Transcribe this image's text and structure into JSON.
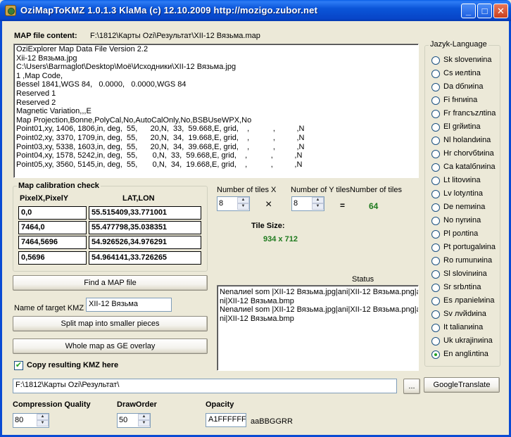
{
  "window": {
    "title": "OziMapToKMZ  1.0.1.3 KlaMa (c) 12.10.2009 http://mozigo.zubor.net",
    "minimize_label": "_",
    "maximize_label": "□",
    "close_label": "✕"
  },
  "map_file": {
    "label": "MAP file content:",
    "path": "F:\\1812\\Карты Ozi\\Результат\\XII-12 Вязьма.map",
    "content_lines": [
      "OziExplorer Map Data File Version 2.2",
      "Xii-12 Вязьма.jpg",
      "C:\\Users\\Barmaglot\\Desktop\\Моё\\Исходники\\XII-12 Вязьма.jpg",
      "1 ,Map Code,",
      "Bessel 1841,WGS 84,   0.0000,   0.0000,WGS 84",
      "Reserved 1",
      "Reserved 2",
      "Magnetic Variation,,,E",
      "Map Projection,Bonne,PolyCal,No,AutoCalOnly,No,BSBUseWPX,No",
      "Point01,xy, 1406, 1806,in, deg,  55,      20,N,  33,  59.668,E, grid,    ,           ,          ,N",
      "Point02,xy, 3370, 1709,in, deg,  55,      20,N,  34,  19.668,E, grid,    ,           ,          ,N",
      "Point03,xy, 5338, 1603,in, deg,  55,      20,N,  34,  39.668,E, grid,    ,           ,          ,N",
      "Point04,xy, 1578, 5242,in, deg,  55,       0,N,  33,  59.668,E, grid,    ,           ,          ,N",
      "Point05,xy, 3560, 5145,in, deg,  55,       0,N,  34,  19.668,E, grid,    ,           ,          ,N"
    ]
  },
  "calibration": {
    "title": "Map calibration check",
    "col1_header": "PixelX,PixelY",
    "col2_header": "LAT,LON",
    "rows": [
      {
        "pixel": "0,0",
        "latlon": "55.515409,33.771001"
      },
      {
        "pixel": "7464,0",
        "latlon": "55.477798,35.038351"
      },
      {
        "pixel": "7464,5696",
        "latlon": "54.926526,34.976291"
      },
      {
        "pixel": "0,5696",
        "latlon": "54.964141,33.726265"
      }
    ]
  },
  "tiles": {
    "x_label": "Number of tiles X",
    "y_label": "Number of Y tiles",
    "total_label": "Number of tiles",
    "x_value": "8",
    "y_value": "8",
    "times": "×",
    "equals": "=",
    "total": "64",
    "size_label": "Tile Size:",
    "size_value": "934 x 712"
  },
  "buttons": {
    "find_map": "Find a MAP file",
    "split": "Split map into smaller pieces",
    "whole": "Whole map as GE overlay",
    "browse": "...",
    "google_translate": "GoogleTranslate"
  },
  "target": {
    "label": "Name of target KMZ",
    "value": "XII-12 Вязьма"
  },
  "copy_kmz": {
    "label": "Copy resulting KMZ here",
    "checked": true
  },
  "status": {
    "label": "Status",
    "lines": [
      "Nenaлиel som |XII-12 Вязьма.jpg|ani|XII-12 Вязьма.png|a",
      "ni|XII-12 Вязьма.bmp",
      "Nenaлиel som |XII-12 Вязьма.jpg|ani|XII-12 Вязьма.png|a",
      "ni|XII-12 Вязьма.bmp"
    ]
  },
  "output_path": "F:\\1812\\Карты Ozi\\Результат\\",
  "compression": {
    "label": "Compression Quality",
    "value": "80"
  },
  "draw_order": {
    "label": "DrawOrder",
    "value": "50"
  },
  "opacity": {
    "label": "Opacity",
    "value": "A1FFFFFF",
    "hint": "aaBBGGRR"
  },
  "language": {
    "title": "Jazyk-Language",
    "selected": "En angliлtina",
    "options": [
      "Sk slovenиina",
      "Cs иeлtina",
      "Da dбnиina",
      "Fi fнnиina",
      "Fr francъzлtina",
      "El grйиtina",
      "Nl holandиina",
      "Hr chorvбtиina",
      "Ca katalбnиina",
      "Lt litovиina",
      "Lv lotyлtina",
      "De nemиina",
      "No nуrиina",
      "Pl poлtina",
      "Pt portugalиina",
      "Ro rumunиina",
      "Sl slovinиina",
      "Sr srbлtina",
      "Es лpanielиina",
      "Sv лvйdиina",
      "It talianиina",
      "Uk ukrajinиina",
      "En angliлtina"
    ]
  },
  "colors": {
    "title_blue": "#0A55D8",
    "tile_green": "#1E7A1E",
    "face": "#ECE9D8"
  }
}
